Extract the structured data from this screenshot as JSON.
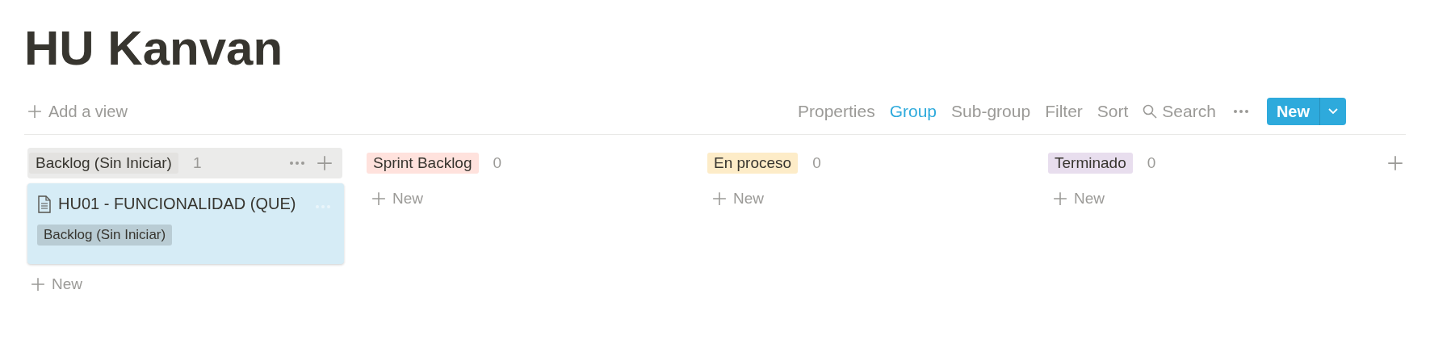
{
  "title": "HU Kanvan",
  "add_view": "Add a view",
  "toolbar": [
    {
      "label": "Properties",
      "selected": false
    },
    {
      "label": "Group",
      "selected": true
    },
    {
      "label": "Sub-group",
      "selected": false
    },
    {
      "label": "Filter",
      "selected": false
    },
    {
      "label": "Sort",
      "selected": false
    }
  ],
  "search": "Search",
  "new_button": "New",
  "columns": [
    {
      "label": "Backlog (Sin Iniciar)",
      "color": "#e3e2e0",
      "count": "1",
      "highlighted": true,
      "new_label": "New",
      "cards": [
        {
          "title": "HU01 - FUNCIONALIDAD (QUE)",
          "tag": "Backlog (Sin Iniciar)"
        }
      ]
    },
    {
      "label": "Sprint Backlog",
      "color": "#ffe2dd",
      "count": "0",
      "highlighted": false,
      "new_label": "New"
    },
    {
      "label": "En proceso",
      "color": "#fdecc8",
      "count": "0",
      "highlighted": false,
      "new_label": "New"
    },
    {
      "label": "Terminado",
      "color": "#e8deee",
      "count": "0",
      "highlighted": false,
      "new_label": "New"
    }
  ]
}
